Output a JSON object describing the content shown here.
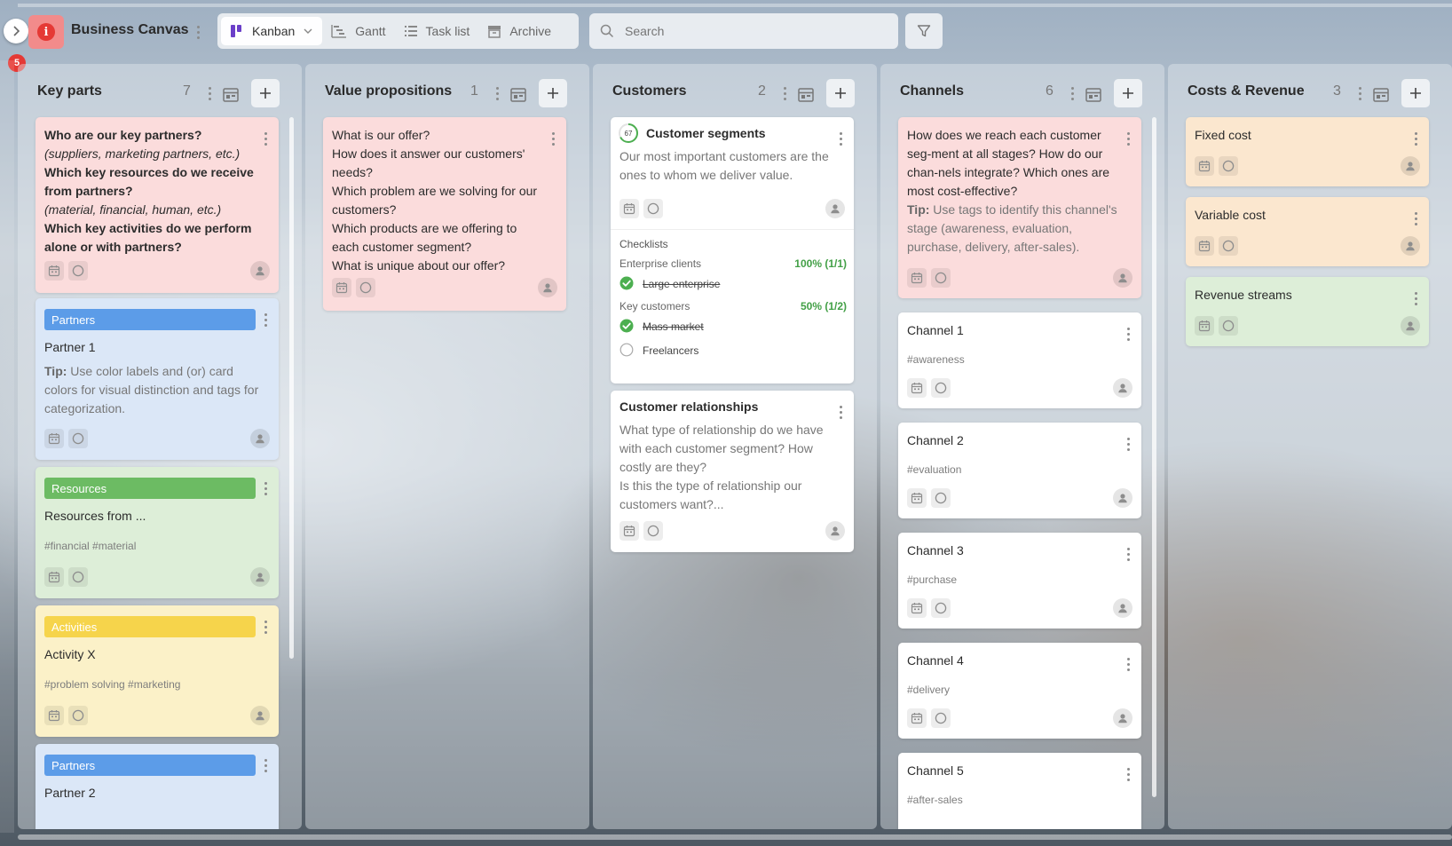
{
  "app": {
    "title": "Business Canvas",
    "notification_count": "5",
    "icon_letter": "i"
  },
  "views": [
    {
      "label": "Kanban",
      "icon": "kanban-icon",
      "active": true
    },
    {
      "label": "Gantt",
      "icon": "gantt-icon"
    },
    {
      "label": "Task list",
      "icon": "list-icon"
    },
    {
      "label": "Archive",
      "icon": "archive-icon"
    }
  ],
  "search": {
    "placeholder": "Search"
  },
  "colors": {
    "pink_card": "#fbdcdc",
    "blue_label": "#5c9ce8",
    "green_label": "#6cbb63",
    "yellow_label": "#f6d44b",
    "check_green": "#4caf50",
    "badge_red": "#e53935"
  },
  "columns": [
    {
      "title": "Key parts",
      "count": "7",
      "cards": [
        {
          "q1": "Who are our key partners?",
          "e1": "(suppliers, marketing partners, etc.)",
          "q2": "Which key resources do we receive from partners?",
          "e2": "(material, financial, human, etc.)",
          "q3": "Which key activities do we perform alone or with partners?"
        },
        {
          "label": "Partners",
          "title": "Partner 1",
          "tip_prefix": "Tip:",
          "tip": "Use color labels and (or) card colors for visual distinction and tags for categorization."
        },
        {
          "label": "Resources",
          "title": "Resources from ...",
          "tags": "#financial #material"
        },
        {
          "label": "Activities",
          "title": "Activity X",
          "tags": "#problem solving #marketing"
        },
        {
          "label": "Partners",
          "title": "Partner 2"
        }
      ]
    },
    {
      "title": "Value propositions",
      "count": "1",
      "cards": [
        {
          "lines": [
            "What is our offer?",
            "How does it answer our customers' needs?",
            "Which problem are we solving for our customers?",
            "Which products are we offering to each customer segment?",
            "What is unique about our offer?"
          ]
        }
      ]
    },
    {
      "title": "Customers",
      "count": "2",
      "cards": [
        {
          "progress": "67",
          "progress_value": 0.67,
          "title": "Customer segments",
          "text": "Our most important customers are the ones to whom we deliver value.",
          "checklists_label": "Checklists",
          "checklists": [
            {
              "name": "Enterprise clients",
              "stat": "100% (1/1)",
              "items": [
                {
                  "text": "Large enterprise",
                  "done": true
                }
              ]
            },
            {
              "name": "Key customers",
              "stat": "50% (1/2)",
              "items": [
                {
                  "text": "Mass market",
                  "done": true
                },
                {
                  "text": "Freelancers",
                  "done": false
                }
              ]
            }
          ]
        },
        {
          "title": "Customer relationships",
          "text1": "What type of relationship do we have with each customer segment? How costly are they?",
          "text2": "Is this the type of relationship our customers want?..."
        }
      ]
    },
    {
      "title": "Channels",
      "count": "6",
      "cards": [
        {
          "text": "How does we reach each customer seg-ment at all stages? How do our chan-nels integrate? Which ones are most cost-effective?",
          "tip_prefix": "Tip:",
          "tip": "Use tags to identify this channel's stage (awareness, evaluation, purchase, delivery, after-sales)."
        },
        {
          "title": "Channel 1",
          "tags": "#awareness"
        },
        {
          "title": "Channel 2",
          "tags": "#evaluation"
        },
        {
          "title": "Channel 3",
          "tags": "#purchase"
        },
        {
          "title": "Channel 4",
          "tags": "#delivery"
        },
        {
          "title": "Channel 5",
          "tags": "#after-sales"
        }
      ]
    },
    {
      "title": "Costs & Revenue",
      "count": "3",
      "cards": [
        {
          "title": "Fixed cost"
        },
        {
          "title": "Variable cost"
        },
        {
          "title": "Revenue streams"
        }
      ]
    }
  ]
}
